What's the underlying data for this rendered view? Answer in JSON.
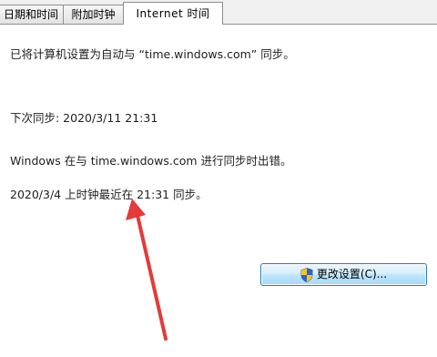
{
  "tabs": [
    {
      "label": "日期和时间"
    },
    {
      "label": "附加时钟"
    },
    {
      "label": "Internet 时间"
    }
  ],
  "content": {
    "sync_setting": "已将计算机设置为自动与 “time.windows.com” 同步。",
    "next_sync": "下次同步: 2020/3/11 21:31",
    "error_message": "Windows 在与 time.windows.com 进行同步时出错。",
    "last_sync": "2020/3/4 上时钟最近在 21:31 同步。"
  },
  "button": {
    "change_settings_label": "更改设置(C)...",
    "icon": "shield-icon"
  },
  "annotation": {
    "arrow_color": "#e23b3b"
  }
}
